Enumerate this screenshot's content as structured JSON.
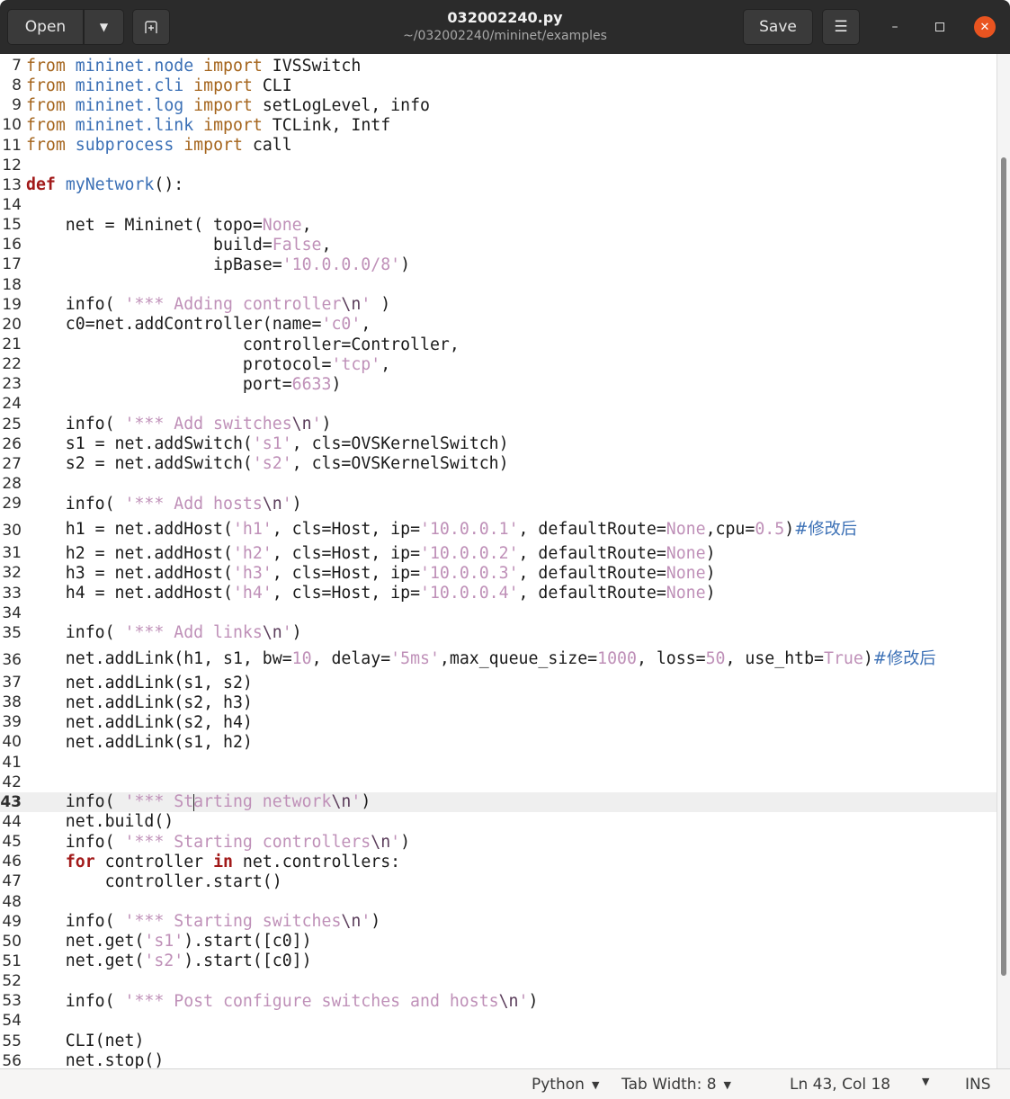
{
  "header": {
    "open_label": "Open",
    "title": "032002240.py",
    "subtitle": "~/032002240/mininet/examples",
    "save_label": "Save"
  },
  "status": {
    "language": "Python",
    "tab_width": "Tab Width: 8",
    "position": "Ln 43, Col 18",
    "mode": "INS"
  },
  "editor": {
    "current_line": 43,
    "lines": [
      {
        "n": "7",
        "t": [
          [
            "k",
            "from"
          ],
          [
            "t",
            " "
          ],
          [
            "m",
            "mininet.node"
          ],
          [
            "t",
            " "
          ],
          [
            "k",
            "import"
          ],
          [
            "t",
            " IVSSwitch"
          ]
        ]
      },
      {
        "n": "8",
        "t": [
          [
            "k",
            "from"
          ],
          [
            "t",
            " "
          ],
          [
            "m",
            "mininet.cli"
          ],
          [
            "t",
            " "
          ],
          [
            "k",
            "import"
          ],
          [
            "t",
            " CLI"
          ]
        ]
      },
      {
        "n": "9",
        "t": [
          [
            "k",
            "from"
          ],
          [
            "t",
            " "
          ],
          [
            "m",
            "mininet.log"
          ],
          [
            "t",
            " "
          ],
          [
            "k",
            "import"
          ],
          [
            "t",
            " setLogLevel, info"
          ]
        ]
      },
      {
        "n": "10",
        "t": [
          [
            "k",
            "from"
          ],
          [
            "t",
            " "
          ],
          [
            "m",
            "mininet.link"
          ],
          [
            "t",
            " "
          ],
          [
            "k",
            "import"
          ],
          [
            "t",
            " TCLink, Intf"
          ]
        ]
      },
      {
        "n": "11",
        "t": [
          [
            "k",
            "from"
          ],
          [
            "t",
            " "
          ],
          [
            "m",
            "subprocess"
          ],
          [
            "t",
            " "
          ],
          [
            "k",
            "import"
          ],
          [
            "t",
            " call"
          ]
        ]
      },
      {
        "n": "12",
        "t": []
      },
      {
        "n": "13",
        "t": [
          [
            "d",
            "def"
          ],
          [
            "t",
            " "
          ],
          [
            "m",
            "myNetwork"
          ],
          [
            "t",
            "():"
          ]
        ]
      },
      {
        "n": "14",
        "t": []
      },
      {
        "n": "15",
        "t": [
          [
            "t",
            "    net = Mininet( topo="
          ],
          [
            "n",
            "None"
          ],
          [
            "t",
            ","
          ]
        ]
      },
      {
        "n": "16",
        "t": [
          [
            "t",
            "                   build="
          ],
          [
            "n",
            "False"
          ],
          [
            "t",
            ","
          ]
        ]
      },
      {
        "n": "17",
        "t": [
          [
            "t",
            "                   ipBase="
          ],
          [
            "s",
            "'10.0.0.0/8'"
          ],
          [
            "t",
            ")"
          ]
        ]
      },
      {
        "n": "18",
        "t": []
      },
      {
        "n": "19",
        "t": [
          [
            "t",
            "    info( "
          ],
          [
            "s",
            "'*** Adding controller"
          ],
          [
            "e",
            "\\n"
          ],
          [
            "s",
            "'"
          ],
          [
            "t",
            " )"
          ]
        ]
      },
      {
        "n": "20",
        "t": [
          [
            "t",
            "    c0=net.addController(name="
          ],
          [
            "s",
            "'c0'"
          ],
          [
            "t",
            ","
          ]
        ]
      },
      {
        "n": "21",
        "t": [
          [
            "t",
            "                      controller=Controller,"
          ]
        ]
      },
      {
        "n": "22",
        "t": [
          [
            "t",
            "                      protocol="
          ],
          [
            "s",
            "'tcp'"
          ],
          [
            "t",
            ","
          ]
        ]
      },
      {
        "n": "23",
        "t": [
          [
            "t",
            "                      port="
          ],
          [
            "n",
            "6633"
          ],
          [
            "t",
            ")"
          ]
        ]
      },
      {
        "n": "24",
        "t": []
      },
      {
        "n": "25",
        "t": [
          [
            "t",
            "    info( "
          ],
          [
            "s",
            "'*** Add switches"
          ],
          [
            "e",
            "\\n"
          ],
          [
            "s",
            "'"
          ],
          [
            "t",
            ")"
          ]
        ]
      },
      {
        "n": "26",
        "t": [
          [
            "t",
            "    s1 = net.addSwitch("
          ],
          [
            "s",
            "'s1'"
          ],
          [
            "t",
            ", cls=OVSKernelSwitch)"
          ]
        ]
      },
      {
        "n": "27",
        "t": [
          [
            "t",
            "    s2 = net.addSwitch("
          ],
          [
            "s",
            "'s2'"
          ],
          [
            "t",
            ", cls=OVSKernelSwitch)"
          ]
        ]
      },
      {
        "n": "28",
        "t": []
      },
      {
        "n": "29",
        "t": [
          [
            "t",
            "    info( "
          ],
          [
            "s",
            "'*** Add hosts"
          ],
          [
            "e",
            "\\n"
          ],
          [
            "s",
            "'"
          ],
          [
            "t",
            ")"
          ]
        ]
      },
      {
        "n": "30",
        "tall": true,
        "t": [
          [
            "t",
            "    h1 = net.addHost("
          ],
          [
            "s",
            "'h1'"
          ],
          [
            "t",
            ", cls=Host, ip="
          ],
          [
            "s",
            "'10.0.0.1'"
          ],
          [
            "t",
            ", defaultRoute="
          ],
          [
            "n",
            "None"
          ],
          [
            "t",
            ",cpu="
          ],
          [
            "n",
            "0.5"
          ],
          [
            "t",
            ")"
          ],
          [
            "c",
            "#修改后"
          ]
        ]
      },
      {
        "n": "31",
        "t": [
          [
            "t",
            "    h2 = net.addHost("
          ],
          [
            "s",
            "'h2'"
          ],
          [
            "t",
            ", cls=Host, ip="
          ],
          [
            "s",
            "'10.0.0.2'"
          ],
          [
            "t",
            ", defaultRoute="
          ],
          [
            "n",
            "None"
          ],
          [
            "t",
            ")"
          ]
        ]
      },
      {
        "n": "32",
        "t": [
          [
            "t",
            "    h3 = net.addHost("
          ],
          [
            "s",
            "'h3'"
          ],
          [
            "t",
            ", cls=Host, ip="
          ],
          [
            "s",
            "'10.0.0.3'"
          ],
          [
            "t",
            ", defaultRoute="
          ],
          [
            "n",
            "None"
          ],
          [
            "t",
            ")"
          ]
        ]
      },
      {
        "n": "33",
        "t": [
          [
            "t",
            "    h4 = net.addHost("
          ],
          [
            "s",
            "'h4'"
          ],
          [
            "t",
            ", cls=Host, ip="
          ],
          [
            "s",
            "'10.0.0.4'"
          ],
          [
            "t",
            ", defaultRoute="
          ],
          [
            "n",
            "None"
          ],
          [
            "t",
            ")"
          ]
        ]
      },
      {
        "n": "34",
        "t": []
      },
      {
        "n": "35",
        "t": [
          [
            "t",
            "    info( "
          ],
          [
            "s",
            "'*** Add links"
          ],
          [
            "e",
            "\\n"
          ],
          [
            "s",
            "'"
          ],
          [
            "t",
            ")"
          ]
        ]
      },
      {
        "n": "36",
        "tall": true,
        "t": [
          [
            "t",
            "    net.addLink(h1, s1, bw="
          ],
          [
            "n",
            "10"
          ],
          [
            "t",
            ", delay="
          ],
          [
            "s",
            "'5ms'"
          ],
          [
            "t",
            ",max_queue_size="
          ],
          [
            "n",
            "1000"
          ],
          [
            "t",
            ", loss="
          ],
          [
            "n",
            "50"
          ],
          [
            "t",
            ", use_htb="
          ],
          [
            "n",
            "True"
          ],
          [
            "t",
            ")"
          ],
          [
            "c",
            "#修改后"
          ]
        ]
      },
      {
        "n": "37",
        "t": [
          [
            "t",
            "    net.addLink(s1, s2)"
          ]
        ]
      },
      {
        "n": "38",
        "t": [
          [
            "t",
            "    net.addLink(s2, h3)"
          ]
        ]
      },
      {
        "n": "39",
        "t": [
          [
            "t",
            "    net.addLink(s2, h4)"
          ]
        ]
      },
      {
        "n": "40",
        "t": [
          [
            "t",
            "    net.addLink(s1, h2)"
          ]
        ]
      },
      {
        "n": "41",
        "t": []
      },
      {
        "n": "42",
        "t": []
      },
      {
        "n": "43",
        "t": [
          [
            "t",
            "    info( "
          ],
          [
            "s",
            "'*** St"
          ],
          [
            "caret",
            ""
          ],
          [
            "s",
            "arting network"
          ],
          [
            "e",
            "\\n"
          ],
          [
            "s",
            "'"
          ],
          [
            "t",
            ")"
          ]
        ]
      },
      {
        "n": "44",
        "t": [
          [
            "t",
            "    net.build()"
          ]
        ]
      },
      {
        "n": "45",
        "t": [
          [
            "t",
            "    info( "
          ],
          [
            "s",
            "'*** Starting controllers"
          ],
          [
            "e",
            "\\n"
          ],
          [
            "s",
            "'"
          ],
          [
            "t",
            ")"
          ]
        ]
      },
      {
        "n": "46",
        "t": [
          [
            "t",
            "    "
          ],
          [
            "d",
            "for"
          ],
          [
            "t",
            " controller "
          ],
          [
            "d",
            "in"
          ],
          [
            "t",
            " net.controllers:"
          ]
        ]
      },
      {
        "n": "47",
        "t": [
          [
            "t",
            "        controller.start()"
          ]
        ]
      },
      {
        "n": "48",
        "t": []
      },
      {
        "n": "49",
        "t": [
          [
            "t",
            "    info( "
          ],
          [
            "s",
            "'*** Starting switches"
          ],
          [
            "e",
            "\\n"
          ],
          [
            "s",
            "'"
          ],
          [
            "t",
            ")"
          ]
        ]
      },
      {
        "n": "50",
        "t": [
          [
            "t",
            "    net.get("
          ],
          [
            "s",
            "'s1'"
          ],
          [
            "t",
            ").start([c0])"
          ]
        ]
      },
      {
        "n": "51",
        "t": [
          [
            "t",
            "    net.get("
          ],
          [
            "s",
            "'s2'"
          ],
          [
            "t",
            ").start([c0])"
          ]
        ]
      },
      {
        "n": "52",
        "t": []
      },
      {
        "n": "53",
        "t": [
          [
            "t",
            "    info( "
          ],
          [
            "s",
            "'*** Post configure switches and hosts"
          ],
          [
            "e",
            "\\n"
          ],
          [
            "s",
            "'"
          ],
          [
            "t",
            ")"
          ]
        ]
      },
      {
        "n": "54",
        "t": []
      },
      {
        "n": "55",
        "t": [
          [
            "t",
            "    CLI(net)"
          ]
        ]
      },
      {
        "n": "56",
        "t": [
          [
            "t",
            "    net.stop()"
          ]
        ]
      }
    ]
  }
}
